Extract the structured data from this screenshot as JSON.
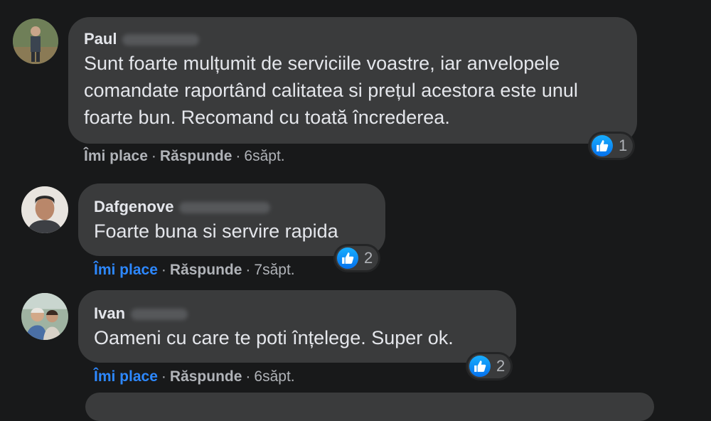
{
  "comments": [
    {
      "author": "Paul",
      "text": "Sunt foarte mulțumit de serviciile voastre, iar anvelopele comandate raportând calitatea si prețul acestora este unul foarte bun. Recomand cu toată încrederea.",
      "like_label": "Îmi place",
      "reply_label": "Răspunde",
      "time": "6săpt.",
      "reactions": "1",
      "liked": false
    },
    {
      "author": "Dafgenove",
      "text": "Foarte buna si servire rapida",
      "like_label": "Îmi place",
      "reply_label": "Răspunde",
      "time": "7săpt.",
      "reactions": "2",
      "liked": true
    },
    {
      "author": "Ivan",
      "text": "Oameni cu care te poti înțelege. Super ok.",
      "like_label": "Îmi place",
      "reply_label": "Răspunde",
      "time": "6săpt.",
      "reactions": "2",
      "liked": true
    }
  ],
  "colors": {
    "background": "#18191a",
    "bubble": "#3a3b3c",
    "liked_link": "#2d88ff",
    "meta_text": "#b0b3b8"
  },
  "icons": {
    "reaction": "thumbs-up-icon"
  }
}
